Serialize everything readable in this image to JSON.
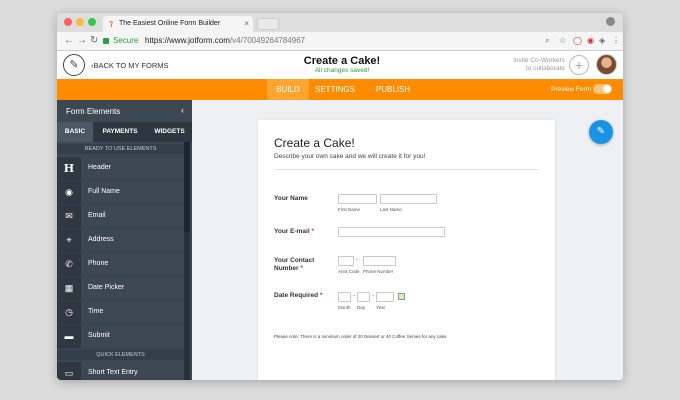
{
  "browser": {
    "tab_title": "The Easiest Online Form Builder",
    "tab_close": "×",
    "secure_label": "Secure",
    "url_host": "https://www.jotform.com",
    "url_path": "/v4/70049264784967"
  },
  "header": {
    "back_label": "BACK TO MY FORMS",
    "form_title": "Create a Cake!",
    "save_status": "All changes saved!",
    "invite_line1": "Invite Co-Workers",
    "invite_line2": "to collaborate",
    "plus_label": "+"
  },
  "nav": {
    "tabs": [
      "BUILD",
      "SETTINGS",
      "PUBLISH"
    ],
    "active_tab": "BUILD",
    "preview_label": "Preview Form",
    "accent_color": "#ff8b00"
  },
  "sidebar": {
    "title": "Form Elements",
    "collapse_icon": "‹",
    "tabs": [
      "BASIC",
      "PAYMENTS",
      "WIDGETS"
    ],
    "section_ready": "READY TO USE ELEMENTS",
    "section_quick": "QUICK ELEMENTS",
    "items": [
      {
        "label": "Header",
        "icon": "H"
      },
      {
        "label": "Full Name",
        "icon": "◉"
      },
      {
        "label": "Email",
        "icon": "✉"
      },
      {
        "label": "Address",
        "icon": "⌖"
      },
      {
        "label": "Phone",
        "icon": "✆"
      },
      {
        "label": "Date Picker",
        "icon": "▦"
      },
      {
        "label": "Time",
        "icon": "◷"
      },
      {
        "label": "Submit",
        "icon": "▬"
      }
    ],
    "quick_items": [
      {
        "label": "Short Text Entry",
        "icon": "▭"
      }
    ]
  },
  "form": {
    "title": "Create a Cake!",
    "subtitle": "Describe your own cake and we will create it for you!",
    "fields": {
      "name_label": "Your Name",
      "first_hint": "First Name",
      "last_hint": "Last Name",
      "email_label": "Your E-mail",
      "contact_label_1": "Your Contact",
      "contact_label_2": "Number",
      "area_hint": "Area Code",
      "phone_hint": "Phone Number",
      "date_label": "Date Required",
      "month_hint": "Month",
      "day_hint": "Day",
      "year_hint": "Year",
      "required_mark": "*",
      "dash": "-"
    },
    "note": "Please note: There is a minimum order of 20 Dessert or 40 Coffee Serves for any cake."
  }
}
